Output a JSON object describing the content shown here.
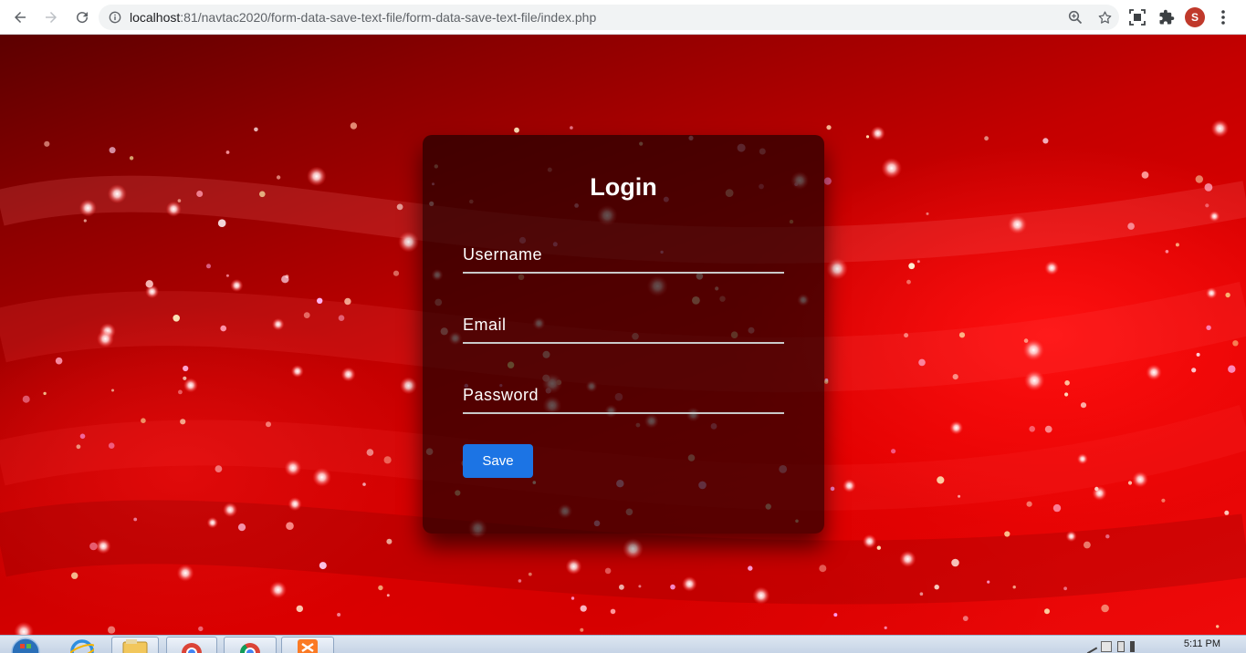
{
  "browser": {
    "url_host": "localhost",
    "url_path": ":81/navtac2020/form-data-save-text-file/form-data-save-text-file/index.php",
    "profile_initial": "S",
    "icons": [
      "back-icon",
      "forward-icon",
      "reload-icon",
      "info-icon",
      "zoom-icon",
      "star-icon",
      "screenshot-icon",
      "extensions-icon",
      "menu-icon"
    ]
  },
  "login": {
    "title": "Login",
    "username_placeholder": "Username",
    "email_placeholder": "Email",
    "password_placeholder": "Password",
    "save_label": "Save"
  },
  "taskbar": {
    "clock": "5:11 PM",
    "icons": [
      "start-orb-icon",
      "internet-explorer-icon",
      "file-explorer-icon",
      "chrome-icon",
      "chrome-icon",
      "xampp-icon"
    ]
  },
  "colors": {
    "accent_button": "#1c74e4",
    "background_red": "#d40000",
    "card_background": "rgba(25,0,0,0.68)"
  }
}
